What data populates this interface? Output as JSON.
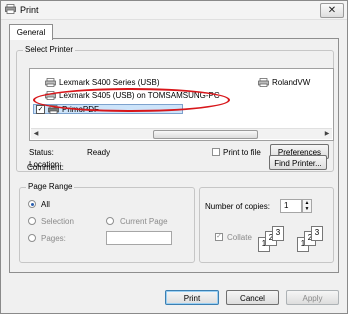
{
  "window": {
    "title": "Print",
    "close_glyph": "✕"
  },
  "tabs": [
    {
      "label": "General"
    }
  ],
  "select_printer": {
    "legend": "Select Printer",
    "printers": [
      {
        "name": "Lexmark S400 Series (USB)",
        "icon": "printer-icon"
      },
      {
        "name": "Lexmark S405 (USB) on TOMSAMSUNG-PC",
        "icon": "network-printer-icon"
      },
      {
        "name": "PrimoPDF",
        "icon": "printer-icon",
        "selected": true,
        "checked": true
      },
      {
        "name": "RolandVW",
        "icon": "printer-icon"
      }
    ],
    "status_label": "Status:",
    "status_value": "Ready",
    "location_label": "Location:",
    "comment_label": "Comment:",
    "print_to_file_label": "Print to file",
    "preferences_label": "Preferences",
    "find_printer_label": "Find Printer..."
  },
  "page_range": {
    "legend": "Page Range",
    "all_label": "All",
    "selection_label": "Selection",
    "current_page_label": "Current Page",
    "pages_label": "Pages:",
    "pages_value": ""
  },
  "copies": {
    "number_label": "Number of copies:",
    "number_value": "1",
    "collate_label": "Collate",
    "collate_checked": true,
    "collate_pages": [
      "1",
      "2",
      "3"
    ]
  },
  "footer": {
    "print_label": "Print",
    "cancel_label": "Cancel",
    "apply_label": "Apply"
  },
  "colors": {
    "annotation": "#d8161a",
    "selection_highlight": "#cde4fa"
  }
}
